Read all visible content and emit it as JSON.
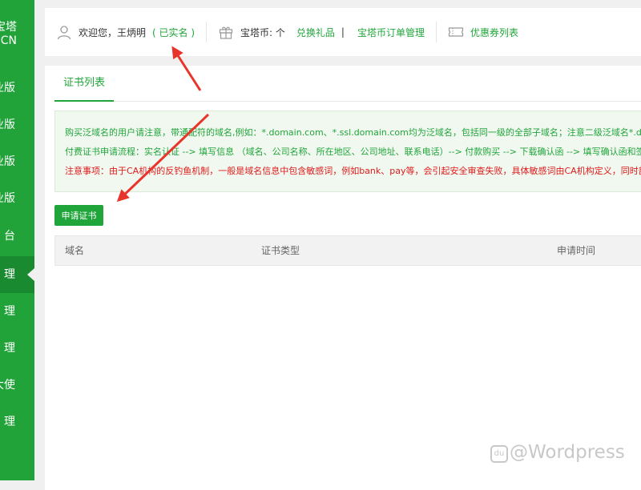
{
  "sidebar": {
    "brand_line1": "宝塔",
    "brand_line2": "CN",
    "items": [
      {
        "label": "业版"
      },
      {
        "label": "业版"
      },
      {
        "label": "专业版"
      },
      {
        "label": "企业版"
      },
      {
        "label": "台"
      },
      {
        "label": "理"
      },
      {
        "label": "理"
      },
      {
        "label": "理"
      },
      {
        "label": "大使"
      },
      {
        "label": "理"
      }
    ],
    "active_index": 5
  },
  "userbar": {
    "welcome": "欢迎您，王炳明",
    "verified": "( 已实名 )",
    "coin_label": "宝塔币: 个",
    "redeem_link": "兑换礼品",
    "pipe": "|",
    "orders_link": "宝塔币订单管理",
    "coupons_link": "优惠券列表"
  },
  "main": {
    "tab_label": "证书列表",
    "notice": {
      "line1": "购买泛域名的用户请注意，带通配符的域名,例如：*.domain.com、*.ssl.domain.com均为泛域名，包括同一级的全部子域名；注意二级泛域名*.domain.com不支持",
      "line2": "付费证书申请流程：实名认证 --> 填写信息 （域名、公司名称、所在地区、公司地址、联系电话）--> 付款购买 --> 下载确认函 --> 填写确认函和签名盖章 --> 上传",
      "line3": "注意事项：由于CA机构的反钓鱼机制，一般是域名信息中包含敏感词，例如bank、pay等，会引起安全审查失败，具体敏感词由CA机构定义，同时部分不常用"
    },
    "apply_button": "申请证书",
    "table": {
      "columns": [
        "域名",
        "证书类型",
        "申请时间"
      ]
    }
  },
  "watermark": {
    "badge": "du",
    "text": "@Wordpress"
  },
  "colors": {
    "sidebar": "#21a33a",
    "accent": "#20a53a",
    "warning": "#e01b1b",
    "annotation_arrow": "#e8352b"
  }
}
